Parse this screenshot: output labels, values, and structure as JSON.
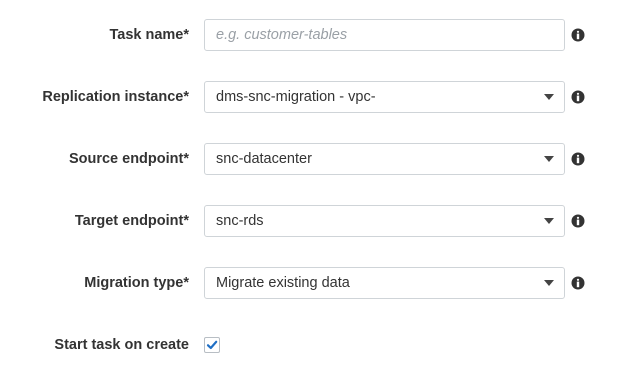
{
  "task_name": {
    "label": "Task name*",
    "placeholder": "e.g. customer-tables",
    "value": ""
  },
  "replication_instance": {
    "label": "Replication instance*",
    "selected": "dms-snc-migration - vpc-"
  },
  "source_endpoint": {
    "label": "Source endpoint*",
    "selected": "snc-datacenter"
  },
  "target_endpoint": {
    "label": "Target endpoint*",
    "selected": "snc-rds"
  },
  "migration_type": {
    "label": "Migration type*",
    "selected": "Migrate existing data"
  },
  "start_task": {
    "label": "Start task on create",
    "checked": true
  },
  "icons": {
    "info": "info-icon",
    "dropdown": "chevron-down-icon",
    "check": "checkmark-icon"
  },
  "colors": {
    "label_text": "#333333",
    "border": "#cfd4d8",
    "placeholder": "#9aa0a6",
    "info_icon": "#333333",
    "check": "#1f6fc5"
  }
}
